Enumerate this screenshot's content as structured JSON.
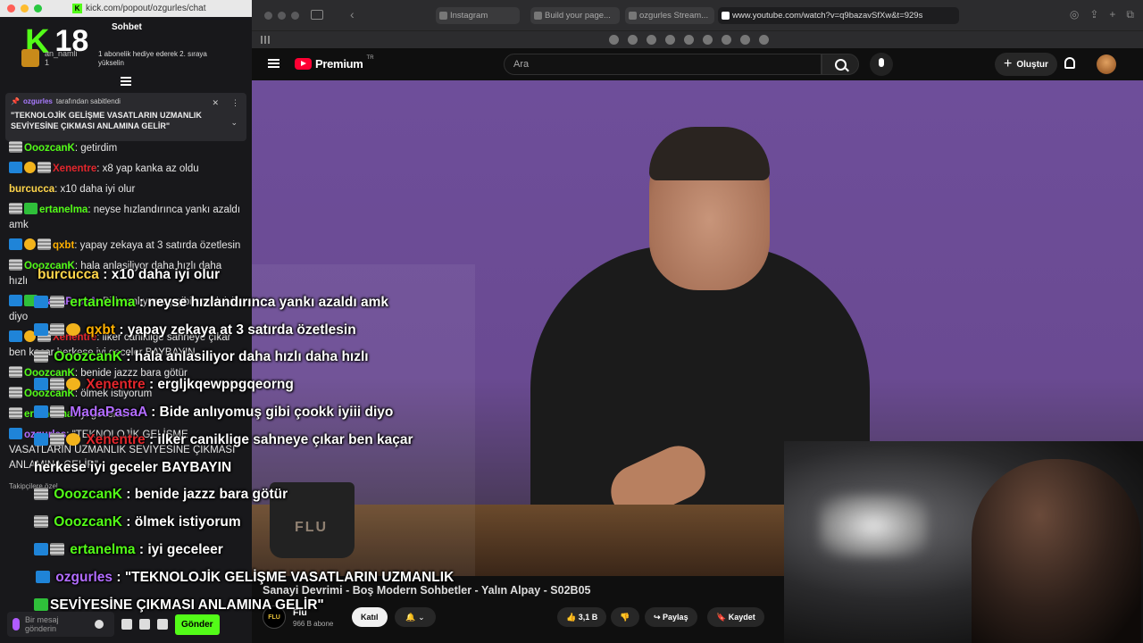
{
  "chat_window": {
    "url": "kick.com/popout/ozgurles/chat",
    "rating_k": "K",
    "rating_age": "18",
    "title": "Sohbet",
    "gift": {
      "user": "an_namli",
      "count": "1",
      "text": "1 abonelik hediye ederek 2. sıraya yükselin"
    },
    "pinned": {
      "pinned_by_user": "ozgurles",
      "pinned_by_suffix": "tarafından sabitlendi",
      "message": "\"TEKNOLOJİK GELİŞME VASATLARIN UZMANLIK SEVİYESİNE ÇIKMASI ANLAMINA GELİR\""
    },
    "messages": [
      {
        "user": "OoozcanK",
        "color": "#53fc18",
        "badges": [
          "grey"
        ],
        "text": "getirdim"
      },
      {
        "user": "Xenentre",
        "color": "#e3262c",
        "badges": [
          "blue",
          "gold",
          "grey"
        ],
        "text": "x8 yap kanka az oldu"
      },
      {
        "user": "burcucca",
        "color": "#ffd54a",
        "badges": [],
        "text": "x10 daha iyi olur"
      },
      {
        "user": "ertanelma",
        "color": "#53fc18",
        "badges": [
          "grey",
          "green"
        ],
        "text": "neyse hızlandırınca yankı azaldı amk"
      },
      {
        "user": "qxbt",
        "color": "#ffb000",
        "badges": [
          "blue",
          "gold",
          "grey"
        ],
        "text": "yapay zekaya at 3 satırda özetlesin"
      },
      {
        "user": "OoozcanK",
        "color": "#53fc18",
        "badges": [
          "grey"
        ],
        "text": "hala anlasiliyor daha hızlı daha hızlı"
      },
      {
        "user": "MadaPasaA",
        "color": "#b26cff",
        "badges": [
          "blue",
          "green"
        ],
        "text": "Bide anlıyomuş gibi çookk iyiii diyo"
      },
      {
        "user": "Xenentre",
        "color": "#e3262c",
        "badges": [
          "blue",
          "gold",
          "grey"
        ],
        "text": "ilker caniklige sahneye çıkar ben kaçar herkese iyi geceler BAYBAYIN"
      },
      {
        "user": "OoozcanK",
        "color": "#53fc18",
        "badges": [
          "grey"
        ],
        "text": "benide jazzz bara götür"
      },
      {
        "user": "OoozcanK",
        "color": "#53fc18",
        "badges": [
          "grey"
        ],
        "text": "ölmek istiyorum"
      },
      {
        "user": "ertanelma",
        "color": "#53fc18",
        "badges": [
          "grey"
        ],
        "text": "iyi geceleer"
      },
      {
        "user": "ozgurles",
        "color": "#b26cff",
        "badges": [
          "mic"
        ],
        "text": "\"TEKNOLOJİK GELİŞME VASATLARIN UZMANLIK SEVİYESİNE ÇIKMASI ANLAMINA GELİR\""
      }
    ],
    "followers_only": "Takipçilere özel",
    "input_placeholder": "Bir mesaj gönderin",
    "send_label": "Gönder"
  },
  "safari": {
    "tabs": [
      {
        "label": "Instagram"
      },
      {
        "label": "Build your page..."
      },
      {
        "label": "ozgurles Stream..."
      },
      {
        "label": "www.youtube.com/watch?v=q9bazavSfXw&t=929s"
      }
    ]
  },
  "youtube": {
    "logo_text": "Premium",
    "region": "TR",
    "search_placeholder": "Ara",
    "create_label": "Oluştur",
    "video_title": "Sanayi Devrimi - Boş Modern Sohbetler - Yalın Alpay - S02B05",
    "channel_name": "Flu",
    "channel_logo_text": "FLU",
    "subscribers": "966 B abone",
    "join_label": "Katıl",
    "likes": "3,1 B",
    "share_label": "Paylaş",
    "save_label": "Kaydet",
    "mug_text": "FLU"
  },
  "overlay_chat": [
    {
      "user": "burcucca",
      "color": "#ffd54a",
      "badges": [],
      "text": ": x10 daha iyi olur"
    },
    {
      "user": "ertanelma",
      "color": "#53fc18",
      "badges": [
        "blue",
        "grey"
      ],
      "text": ": neyse hızlandırınca yankı azaldı amk"
    },
    {
      "user": "qxbt",
      "color": "#ffb000",
      "badges": [
        "blue",
        "grey",
        "gold"
      ],
      "text": ": yapay zekaya at 3 satırda özetlesin"
    },
    {
      "user": "OoozcanK",
      "color": "#53fc18",
      "badges": [
        "grey"
      ],
      "text": ": hala anlasiliyor daha hızlı daha hızlı"
    },
    {
      "user": "Xenentre",
      "color": "#e3262c",
      "badges": [
        "blue",
        "grey",
        "gold"
      ],
      "text": ": ergljkqewppgqeorng"
    },
    {
      "user": "MadaPasaA",
      "color": "#b26cff",
      "badges": [
        "blue",
        "grey"
      ],
      "text": ": Bide anlıyomuş gibi çookk iyiii diyo"
    },
    {
      "user": "Xenentre",
      "color": "#e3262c",
      "badges": [
        "blue",
        "grey",
        "gold"
      ],
      "text": ": ilker caniklige sahneye çıkar ben kaçar"
    },
    {
      "user": "",
      "color": "#ffffff",
      "badges": [],
      "text": "herkese iyi geceler BAYBAYIN"
    },
    {
      "user": "OoozcanK",
      "color": "#53fc18",
      "badges": [
        "grey"
      ],
      "text": ": benide jazzz bara götür"
    },
    {
      "user": "OoozcanK",
      "color": "#53fc18",
      "badges": [
        "grey"
      ],
      "text": ": ölmek istiyorum"
    },
    {
      "user": "ertanelma",
      "color": "#53fc18",
      "badges": [
        "blue",
        "grey"
      ],
      "text": ": iyi geceleer"
    },
    {
      "user": "ozgurles",
      "color": "#b26cff",
      "badges": [
        "mic"
      ],
      "text": ": \"TEKNOLOJİK GELİŞME VASATLARIN UZMANLIK"
    },
    {
      "user": "",
      "color": "#ffffff",
      "badges": [
        "green"
      ],
      "text": "SEVİYESİNE ÇIKMASI ANLAMINA GELİR\""
    }
  ]
}
